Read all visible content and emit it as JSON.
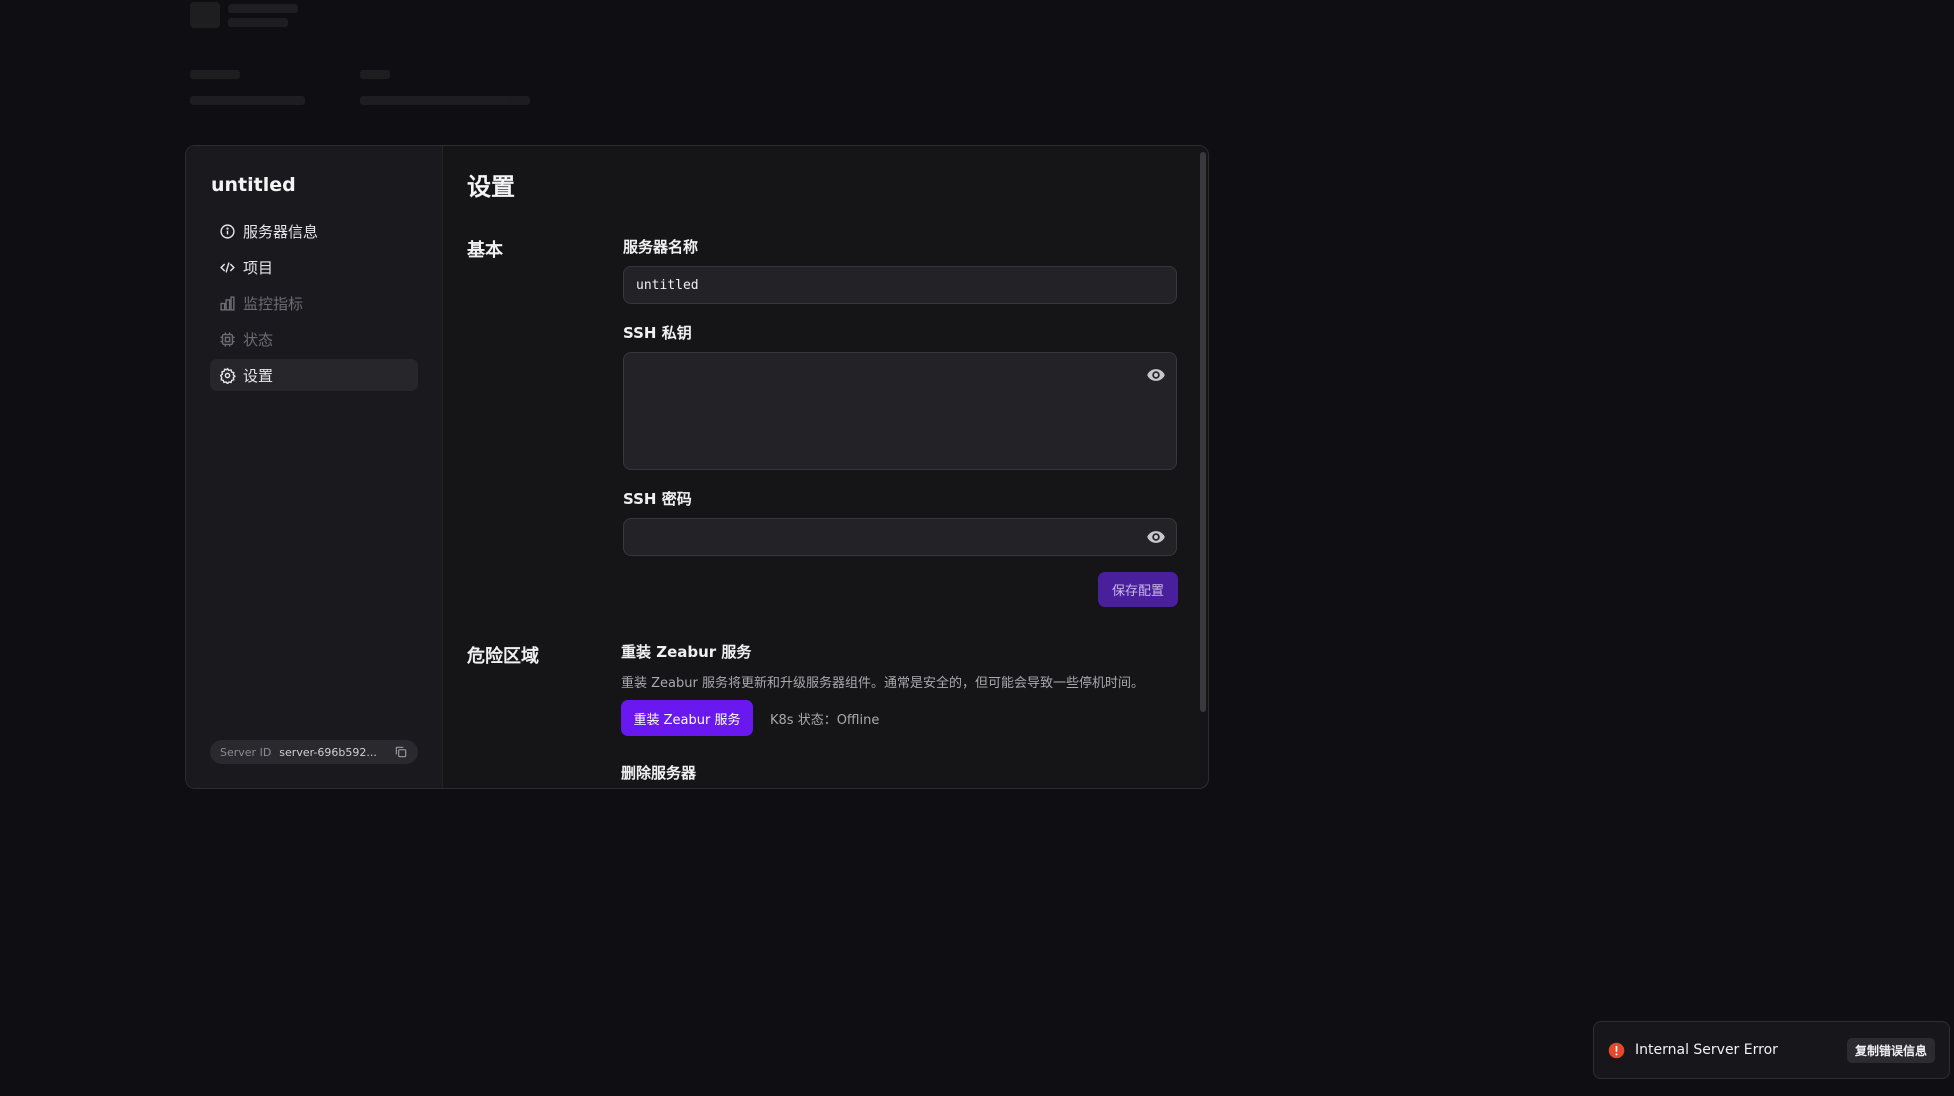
{
  "sidebar": {
    "title": "untitled",
    "items": [
      {
        "label": "服务器信息",
        "icon": "info-icon",
        "state": "normal"
      },
      {
        "label": "项目",
        "icon": "code-icon",
        "state": "normal"
      },
      {
        "label": "监控指标",
        "icon": "bar-chart-icon",
        "state": "disabled"
      },
      {
        "label": "状态",
        "icon": "cpu-icon",
        "state": "disabled"
      },
      {
        "label": "设置",
        "icon": "gear-icon",
        "state": "active"
      }
    ],
    "server_id_label": "Server ID",
    "server_id_value": "server-696b592..."
  },
  "main": {
    "title": "设置",
    "basic": {
      "section_label": "基本",
      "server_name_label": "服务器名称",
      "server_name_value": "untitled",
      "ssh_key_label": "SSH 私钥",
      "ssh_key_value": "",
      "ssh_password_label": "SSH 密码",
      "ssh_password_value": "",
      "save_label": "保存配置"
    },
    "danger": {
      "section_label": "危险区域",
      "reinstall_title": "重装 Zeabur 服务",
      "reinstall_desc": "重装 Zeabur 服务将更新和升级服务器组件。通常是安全的，但可能会导致一些停机时间。",
      "reinstall_button": "重装 Zeabur 服务",
      "k8s_status": "K8s 状态：Offline",
      "delete_title": "删除服务器"
    }
  },
  "toast": {
    "message": "Internal Server Error",
    "copy_label": "复制错误信息",
    "status_color": "#e5482d"
  },
  "colors": {
    "accent": "#6a18f0",
    "save_bg": "#4a1f9c"
  }
}
